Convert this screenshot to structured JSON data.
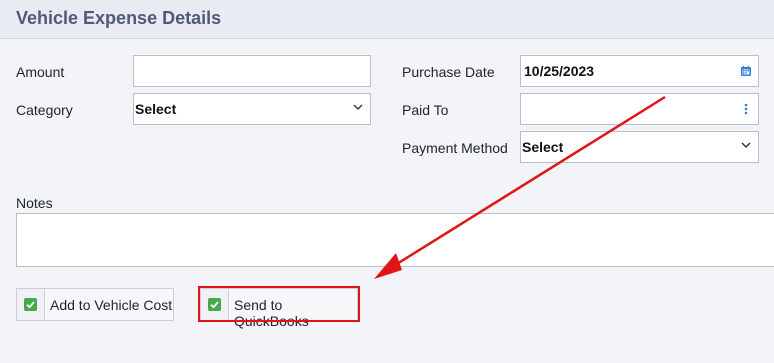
{
  "header": {
    "title": "Vehicle Expense Details"
  },
  "left": {
    "amount_label": "Amount",
    "amount_value": "",
    "category_label": "Category",
    "category_value": "Select"
  },
  "right": {
    "purchase_date_label": "Purchase Date",
    "purchase_date_value": "10/25/2023",
    "paid_to_label": "Paid To",
    "paid_to_value": "",
    "payment_method_label": "Payment Method",
    "payment_method_value": "Select"
  },
  "notes": {
    "label": "Notes",
    "value": ""
  },
  "checkboxes": [
    {
      "label": "Add to Vehicle Cost",
      "checked": true
    },
    {
      "label": "Send to QuickBooks",
      "checked": true
    }
  ],
  "colors": {
    "header_bg": "#e8ebf1",
    "title": "#4f5a78",
    "checkbox_green": "#46a94d",
    "annotation_red": "#e01515",
    "icon_blue": "#2f7ed8"
  },
  "icons": [
    "calendar-icon",
    "more-vertical-icon",
    "chevron-down-icon",
    "check-icon"
  ]
}
